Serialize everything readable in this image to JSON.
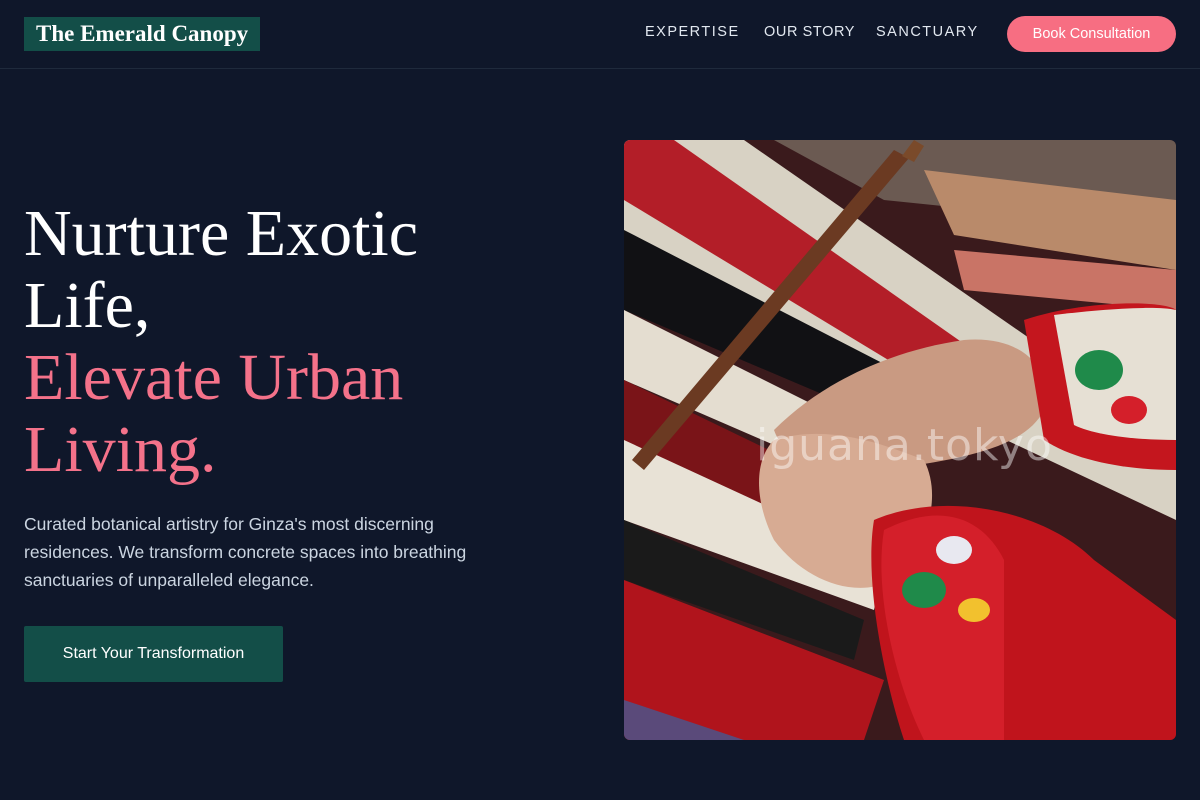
{
  "brand": {
    "name": "The Emerald Canopy"
  },
  "nav": {
    "items": [
      "EXPERTISE",
      "OUR STORY",
      "SANCTUARY"
    ],
    "cta": "Book Consultation"
  },
  "hero": {
    "title_lines": [
      "Nurture Exotic",
      "Life,"
    ],
    "accent_lines": [
      "Elevate Urban",
      "Living."
    ],
    "subtitle_lines": [
      "Curated botanical artistry for Ginza's most discerning",
      "residences. We transform concrete spaces into breathing",
      "sanctuaries of unparalleled elegance."
    ],
    "cta": "Start Your Transformation"
  },
  "image": {
    "watermark": "iguana.tokyo"
  },
  "colors": {
    "background": "#0f172a",
    "brand": "#134e48",
    "accent": "#f76e82"
  }
}
